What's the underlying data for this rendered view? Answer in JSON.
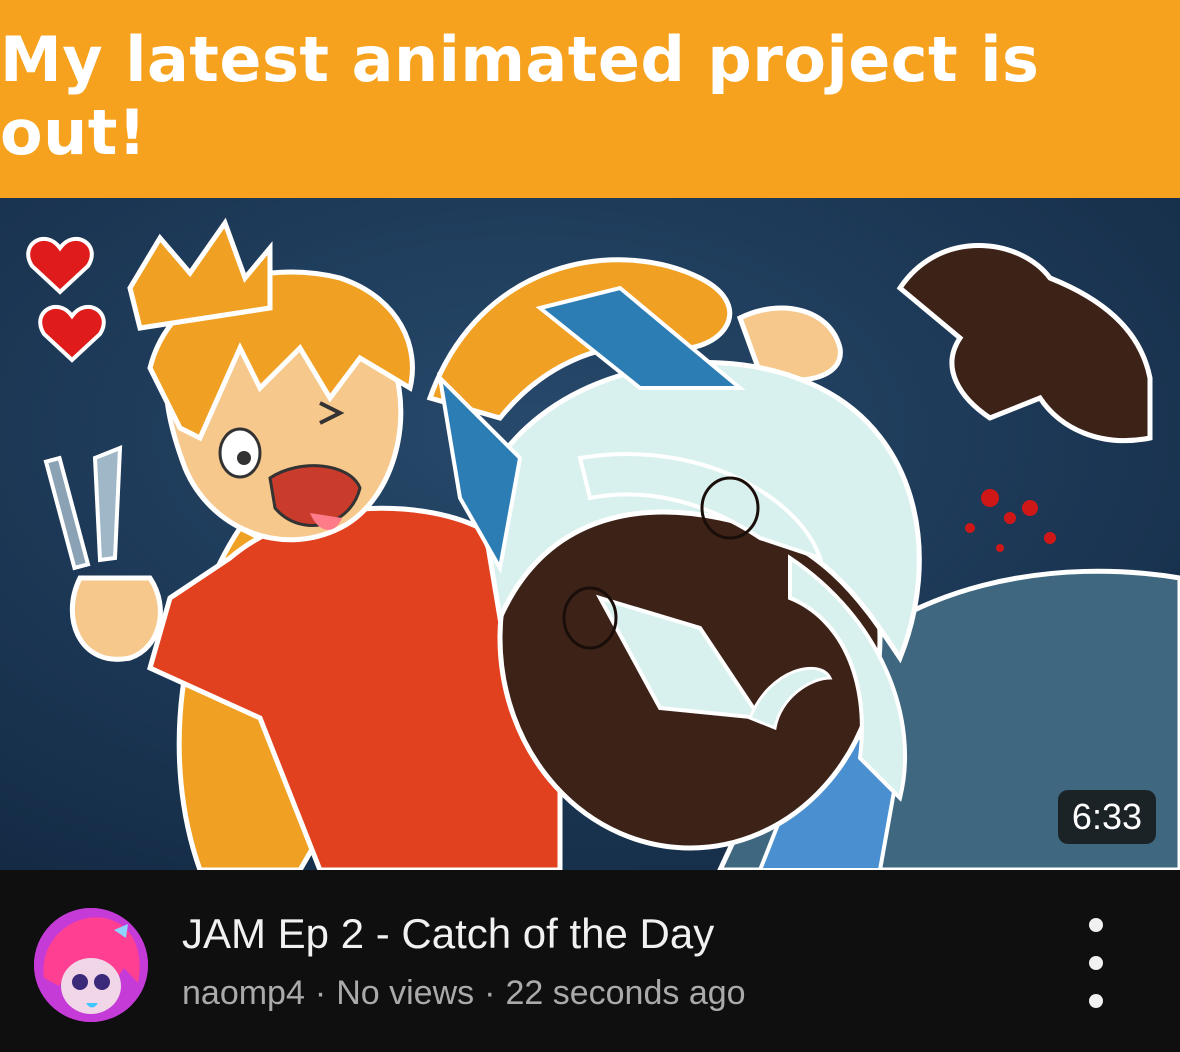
{
  "banner": {
    "text": "My latest animated project is out!"
  },
  "video": {
    "duration": "6:33",
    "title": "JAM Ep 2 - Catch of the Day",
    "channel": "naomp4",
    "views": "No views",
    "age": "22 seconds ago"
  },
  "colors": {
    "banner_bg": "#f6a21e",
    "page_bg": "#0f0f0f",
    "title_text": "#f1f1f1",
    "meta_text": "#aaaaaa"
  },
  "icons": {
    "more": "more-vert-icon",
    "avatar": "channel-avatar"
  }
}
